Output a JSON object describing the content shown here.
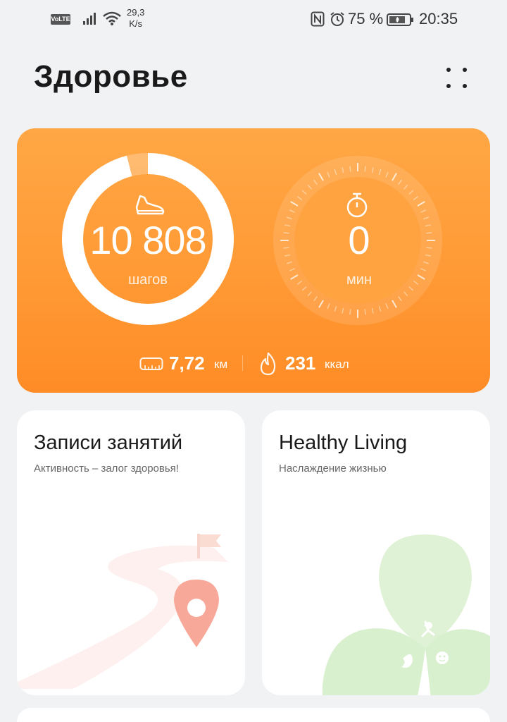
{
  "status_bar": {
    "volte": "VoLTE",
    "net_speed_value": "29,3",
    "net_speed_unit": "K/s",
    "battery": "75 %",
    "time": "20:35"
  },
  "header": {
    "title": "Здоровье"
  },
  "summary": {
    "steps": "10 808",
    "steps_unit": "шагов",
    "steps_progress": 0.96,
    "minutes": "0",
    "minutes_unit": "мин",
    "distance": "7,72",
    "distance_unit": "км",
    "calories": "231",
    "calories_unit": "ккал"
  },
  "cards": {
    "workouts": {
      "title": "Записи занятий",
      "subtitle": "Активность – залог здоровья!"
    },
    "healthy_living": {
      "title": "Healthy Living",
      "subtitle": "Наслаждение жизнью"
    }
  },
  "colors": {
    "accent": "#ff9a35",
    "background": "#f1f2f4"
  }
}
